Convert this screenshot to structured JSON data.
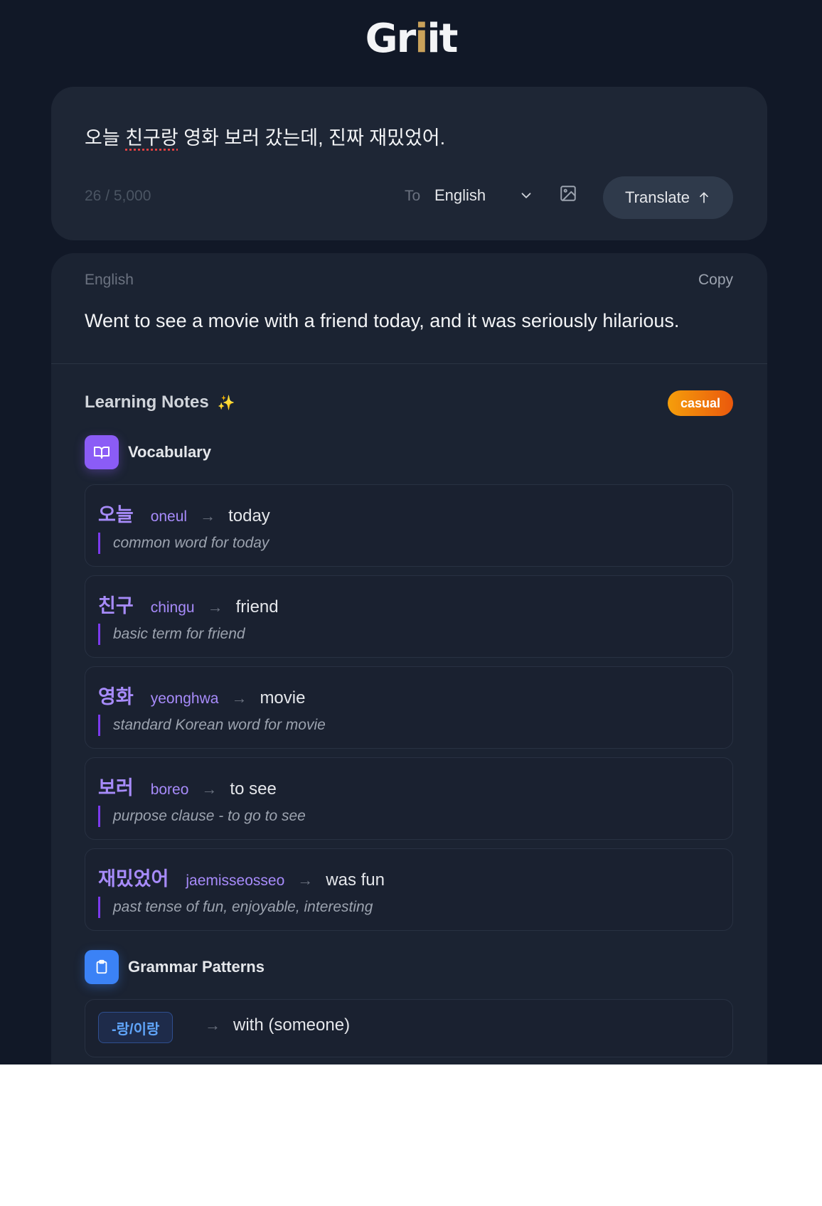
{
  "app": {
    "logo_prefix": "Gr",
    "logo_accent": "i",
    "logo_suffix": "it"
  },
  "input": {
    "text_before": "오늘 ",
    "text_flagged": "친구랑",
    "text_after": " 영화 보러 갔는데, 진짜 재밌었어.",
    "char_count": "26 / 5,000",
    "to_label": "To",
    "target_language": "English",
    "translate_label": "Translate"
  },
  "result": {
    "language": "English",
    "copy_label": "Copy",
    "text": "Went to see a movie with a friend today, and it was seriously hilarious."
  },
  "notes": {
    "title": "Learning Notes",
    "sparkle": "✨",
    "tone_badge": "casual",
    "vocabulary_title": "Vocabulary",
    "vocabulary": [
      {
        "korean": "오늘",
        "romanization": "oneul",
        "meaning": "today",
        "note": "common word for today"
      },
      {
        "korean": "친구",
        "romanization": "chingu",
        "meaning": "friend",
        "note": "basic term for friend"
      },
      {
        "korean": "영화",
        "romanization": "yeonghwa",
        "meaning": "movie",
        "note": "standard Korean word for movie"
      },
      {
        "korean": "보러",
        "romanization": "boreo",
        "meaning": "to see",
        "note": "purpose clause - to go to see"
      },
      {
        "korean": "재밌었어",
        "romanization": "jaemisseosseo",
        "meaning": "was fun",
        "note": "past tense of fun, enjoyable, interesting"
      }
    ],
    "grammar_title": "Grammar Patterns",
    "grammar": [
      {
        "pattern": "-랑/이랑",
        "meaning": "with (someone)"
      }
    ]
  },
  "icons": {
    "arrow": "→",
    "chevron": "chevron-down-icon",
    "image": "image-icon",
    "up_arrow": "arrow-up-icon",
    "book": "book-icon",
    "clipboard": "clipboard-icon"
  },
  "colors": {
    "background": "#111827",
    "card": "#1e2635",
    "accent_purple": "#a78bfa",
    "accent_blue": "#3b82f6",
    "badge_orange": "#ea580c",
    "logo_gold": "#c9a15a"
  }
}
